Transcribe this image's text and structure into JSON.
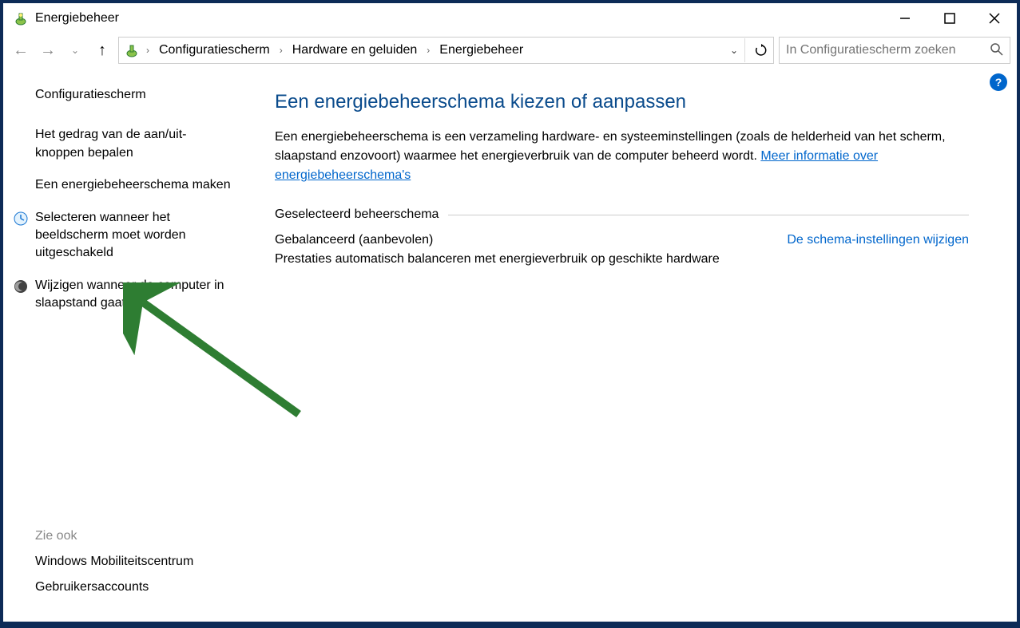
{
  "titlebar": {
    "title": "Energiebeheer"
  },
  "breadcrumb": {
    "items": [
      "Configuratiescherm",
      "Hardware en geluiden",
      "Energiebeheer"
    ]
  },
  "search": {
    "placeholder": "In Configuratiescherm zoeken"
  },
  "sidebar": {
    "home": "Configuratiescherm",
    "links": [
      "Het gedrag van de aan/uit-knoppen bepalen",
      "Een energiebeheerschema maken",
      "Selecteren wanneer het beeldscherm moet worden uitgeschakeld",
      "Wijzigen wanneer de computer in slaapstand gaat"
    ],
    "see_also_title": "Zie ook",
    "see_also": [
      "Windows Mobiliteitscentrum",
      "Gebruikersaccounts"
    ]
  },
  "main": {
    "heading": "Een energiebeheerschema kiezen of aanpassen",
    "desc_part1": "Een energiebeheerschema is een verzameling hardware- en systeeminstellingen (zoals de helderheid van het scherm, slaapstand enzovoort) waarmee het energieverbruik van de computer beheerd wordt. ",
    "desc_link": "Meer informatie over energiebeheerschema's",
    "section_title": "Geselecteerd beheerschema",
    "plan_name": "Gebalanceerd (aanbevolen)",
    "plan_change": "De schema-instellingen wijzigen",
    "plan_desc": "Prestaties automatisch balanceren met energieverbruik op geschikte hardware"
  }
}
